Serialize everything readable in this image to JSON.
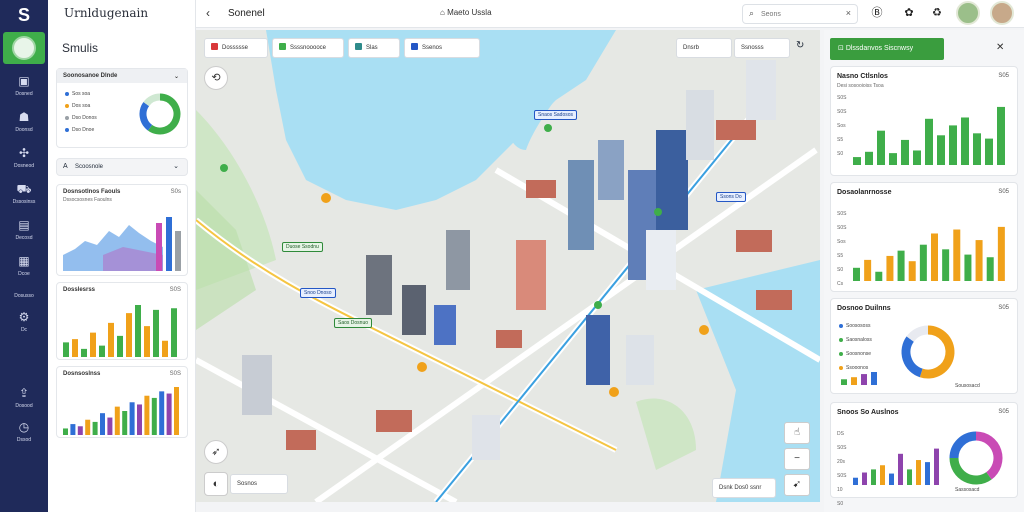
{
  "app": {
    "logo": "S",
    "title": "Urnldugenain",
    "sidebar_title": "Smulis"
  },
  "rail": {
    "items": [
      {
        "icon": "calendar-icon",
        "glyph": "▣",
        "label": "Dosned"
      },
      {
        "icon": "school-icon",
        "glyph": "☗",
        "label": "Doonsd"
      },
      {
        "icon": "network-icon",
        "glyph": "✣",
        "label": "Dosneod"
      },
      {
        "icon": "cart-icon",
        "glyph": "⛟",
        "label": "Dssosinss"
      },
      {
        "icon": "chart-icon",
        "glyph": "▤",
        "label": "Decosd"
      },
      {
        "icon": "table-icon",
        "glyph": "▦",
        "label": "Dcoe"
      },
      {
        "icon": "gear-icon",
        "glyph": "⚙",
        "label": "Dc"
      },
      {
        "icon": "export-icon",
        "glyph": "⇪",
        "label": "Dosood"
      },
      {
        "icon": "clock-icon",
        "glyph": "◷",
        "label": "Dssod"
      }
    ],
    "extra_label": "Dosusso"
  },
  "topbar": {
    "title": "Sonenel",
    "center_label": "Maeto Ussla",
    "search_placeholder": "Seons",
    "icons": [
      "bold-icon",
      "flower-icon",
      "recycle-icon"
    ]
  },
  "sidebar": {
    "filter_card": {
      "title": "Soonosanoe Dlnde",
      "legend": [
        {
          "label": "Sos soa",
          "color": "#2f6fd6"
        },
        {
          "label": "Dos soa",
          "color": "#f0a11a"
        },
        {
          "label": "Dso Donos",
          "color": "#9aa0a6"
        },
        {
          "label": "Dso Dnoe",
          "color": "#2f6fd6"
        }
      ],
      "donut": {
        "values": [
          60,
          25,
          15
        ],
        "colors": [
          "#3fae4a",
          "#2f6fd6",
          "#cfe8d2"
        ]
      }
    },
    "section2": {
      "title": "Scoosnole"
    },
    "area_card": {
      "title": "Dosnsotlnos Faouls",
      "value": "S0s",
      "subtitle": "Dssocsosnes Faoulns"
    },
    "bar_card": {
      "title": "Dosslesrss",
      "value": "S0S"
    },
    "bar_card2": {
      "title": "Dosnsoslnss",
      "value": "S0S"
    }
  },
  "map": {
    "chips": [
      {
        "label": "Dossssse",
        "color": "#d9383a"
      },
      {
        "label": "Ssssnooooce",
        "color": "#3fae4a"
      },
      {
        "label": "Slas",
        "color": "#2e8b8b"
      },
      {
        "label": "Ssenos",
        "color": "#2457c5"
      }
    ],
    "right_chips": [
      "Dnsrb",
      "Ssnosss"
    ],
    "poi_labels": [
      "Duose Ssodnu",
      "Snoo Dnoso",
      "Saos Dosnuo",
      "Snaos Sadosos",
      "Ssons Do"
    ],
    "bottom_chip": "Sosnos",
    "zoom_label": "Dsnk Dos0 ssnr"
  },
  "right_panel": {
    "header": "Dlssdanvos Siscnwsy",
    "cards": [
      {
        "title": "Nasno Ctlsnlos",
        "value": "S05",
        "sub": "Desi sosooioiss Tsoa",
        "ticks": [
          "S0S",
          "S0S",
          "Sos",
          "S5",
          "S0"
        ],
        "chart_data": {
          "type": "bar",
          "values": [
            12,
            20,
            52,
            18,
            38,
            22,
            70,
            45,
            60,
            72,
            48,
            40,
            88
          ],
          "colors": [
            "#3fae4a"
          ]
        }
      },
      {
        "title": "Dosaolanrnosse",
        "value": "S05",
        "ticks": [
          "S0S",
          "S0S",
          "Sos",
          "S5",
          "S0",
          "Cs"
        ],
        "chart_data": {
          "type": "bar",
          "values": [
            20,
            32,
            14,
            38,
            46,
            30,
            55,
            72,
            48,
            78,
            40,
            62,
            36,
            82
          ],
          "colors": [
            "#3fae4a",
            "#f0a11a"
          ]
        }
      },
      {
        "title": "Dosnoo Duilnns",
        "value": "S05",
        "legend": [
          {
            "label": "Soosososs",
            "color": "#2f6fd6"
          },
          {
            "label": "Saosnaloss",
            "color": "#3fae4a"
          },
          {
            "label": "Soosnonse",
            "color": "#3fae4a"
          },
          {
            "label": "Ssooonos",
            "color": "#f0a11a"
          }
        ],
        "chart_data": {
          "type": "bar",
          "values": [
            22,
            30,
            42,
            50
          ],
          "colors": [
            "#3fae4a",
            "#f0a11a",
            "#8e44ad",
            "#2f6fd6"
          ]
        },
        "donut": {
          "values": [
            55,
            30,
            15
          ],
          "colors": [
            "#f0a11a",
            "#2f6fd6",
            "#e8eaf0"
          ]
        },
        "donut_label": "Sousosacd"
      },
      {
        "title": "Snoos So Auslnos",
        "value": "S05",
        "ticks": [
          "DS",
          "S0S",
          "20s",
          "S0S",
          "10",
          "S0"
        ],
        "chart_data": {
          "type": "bar",
          "values": [
            14,
            24,
            30,
            38,
            22,
            60,
            30,
            48,
            44,
            70
          ],
          "colors": [
            "#2f6fd6",
            "#8e44ad",
            "#3fae4a",
            "#f0a11a"
          ]
        },
        "donut": {
          "values": [
            40,
            35,
            25
          ],
          "colors": [
            "#c94bb5",
            "#3fae4a",
            "#2f6fd6"
          ]
        },
        "donut_label": "Sassosacd"
      }
    ]
  }
}
